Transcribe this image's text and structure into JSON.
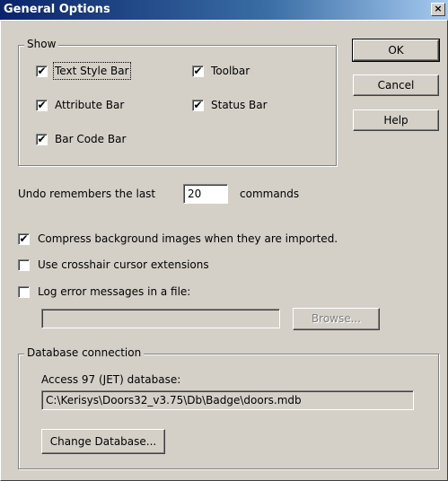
{
  "window": {
    "title": "General Options",
    "close_glyph": "×"
  },
  "show_group": {
    "legend": "Show",
    "items": [
      {
        "label": "Text Style Bar",
        "checked": true
      },
      {
        "label": "Toolbar",
        "checked": true
      },
      {
        "label": "Attribute Bar",
        "checked": true
      },
      {
        "label": "Status Bar",
        "checked": true
      },
      {
        "label": "Bar Code Bar",
        "checked": true
      }
    ]
  },
  "buttons": {
    "ok": "OK",
    "cancel": "Cancel",
    "help": "Help"
  },
  "undo": {
    "prefix": "Undo remembers the last",
    "value": "20",
    "suffix": "commands"
  },
  "options": [
    {
      "label": "Compress background images when they are imported.",
      "checked": true
    },
    {
      "label": "Use crosshair cursor extensions",
      "checked": false
    },
    {
      "label": "Log error messages in a file:",
      "checked": false
    }
  ],
  "log_file": {
    "value": "",
    "browse_label": "Browse..."
  },
  "database": {
    "legend": "Database connection",
    "type_label": "Access 97 (JET) database:",
    "path": "C:\\Kerisys\\Doors32_v3.75\\Db\\Badge\\doors.mdb",
    "change_label": "Change Database..."
  },
  "check_glyph": "✔"
}
